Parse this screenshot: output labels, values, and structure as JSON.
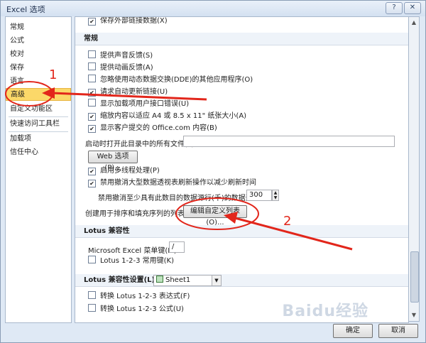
{
  "window": {
    "title": "Excel 选项"
  },
  "titlebar": {
    "help_glyph": "?",
    "close_glyph": "✕"
  },
  "sidebar": {
    "items": [
      {
        "label": "常规"
      },
      {
        "label": "公式"
      },
      {
        "label": "校对"
      },
      {
        "label": "保存"
      },
      {
        "label": "语言"
      },
      {
        "label": "高级"
      },
      {
        "label": "自定义功能区"
      },
      {
        "label": "快速访问工具栏"
      },
      {
        "label": "加载项"
      },
      {
        "label": "信任中心"
      }
    ],
    "selected": "高级"
  },
  "content": {
    "top_partial": {
      "label": "保存外部链接数据(X)",
      "checked": true
    },
    "general_header": "常规",
    "options": [
      {
        "label": "提供声音反馈(S)",
        "checked": false
      },
      {
        "label": "提供动画反馈(A)",
        "checked": false
      },
      {
        "label": "忽略使用动态数据交换(DDE)的其他应用程序(O)",
        "checked": false
      },
      {
        "label": "请求自动更新链接(U)",
        "checked": true
      },
      {
        "label": "显示加载项用户接口错误(U)",
        "checked": false
      },
      {
        "label": "缩放内容以适应 A4 或 8.5 x 11\" 纸张大小(A)",
        "checked": true
      },
      {
        "label": "显示客户提交的 Office.com 内容(B)",
        "checked": true
      }
    ],
    "startup_label": "启动时打开此目录中的所有文件(L):",
    "startup_value": "",
    "web_options_button": "Web 选项(P)...",
    "multithread": {
      "label": "启用多线程处理(P)",
      "checked": true
    },
    "pivot_undo": {
      "label": "禁用撤消大型数据透视表刷新操作以减少刷新时间",
      "checked": true
    },
    "pivot_rows_label": "禁用撤消至少具有此数目的数据源行(千)的数据透视表:",
    "pivot_rows_value": "300",
    "custom_list_label": "创建用于排序和填充序列的列表:",
    "custom_list_button": "编辑自定义列表(O)...",
    "lotus_header": "Lotus 兼容性",
    "menu_key_label": "Microsoft Excel 菜单键(M):",
    "menu_key_value": "/",
    "lotus_nav": {
      "label": "Lotus 1-2-3 常用键(K)",
      "checked": false
    },
    "lotus_settings_label": "Lotus 兼容性设置(L):",
    "lotus_settings_sheet": "Sheet1",
    "lotus_formula_eval": {
      "label": "转换 Lotus 1-2-3 表达式(F)",
      "checked": false
    },
    "lotus_formula_entry": {
      "label": "转换 Lotus 1-2-3 公式(U)",
      "checked": false
    }
  },
  "footer": {
    "ok_label": "确定",
    "cancel_label": "取消"
  },
  "annotations": {
    "one": "1",
    "two": "2",
    "color": "#e2261b"
  },
  "watermark": "Baidu经验"
}
